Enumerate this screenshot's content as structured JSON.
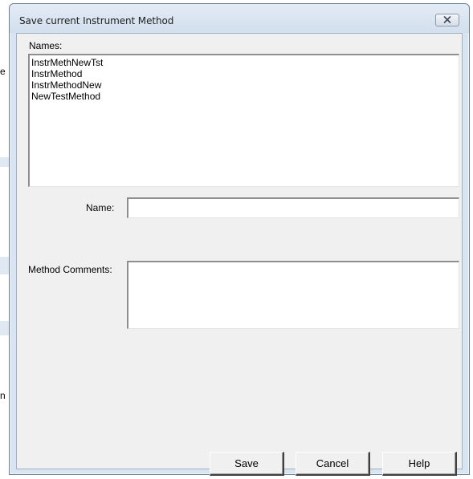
{
  "window": {
    "title": "Save current Instrument Method"
  },
  "names": {
    "label": "Names:",
    "items": [
      {
        "label": "InstrMethNewTst"
      },
      {
        "label": "InstrMethod"
      },
      {
        "label": "InstrMethodNew"
      },
      {
        "label": "NewTestMethod"
      }
    ]
  },
  "name_field": {
    "label": "Name:",
    "value": ""
  },
  "comments_field": {
    "label": "Method Comments:",
    "value": ""
  },
  "buttons": {
    "save": "Save",
    "cancel": "Cancel",
    "help": "Help"
  },
  "background": {
    "glyph_e": "e",
    "glyph_n": "n"
  },
  "icons": {
    "close": "close-icon"
  },
  "colors": {
    "title_bar": "#d9e4f1",
    "client_bg": "#f0f0f0"
  }
}
